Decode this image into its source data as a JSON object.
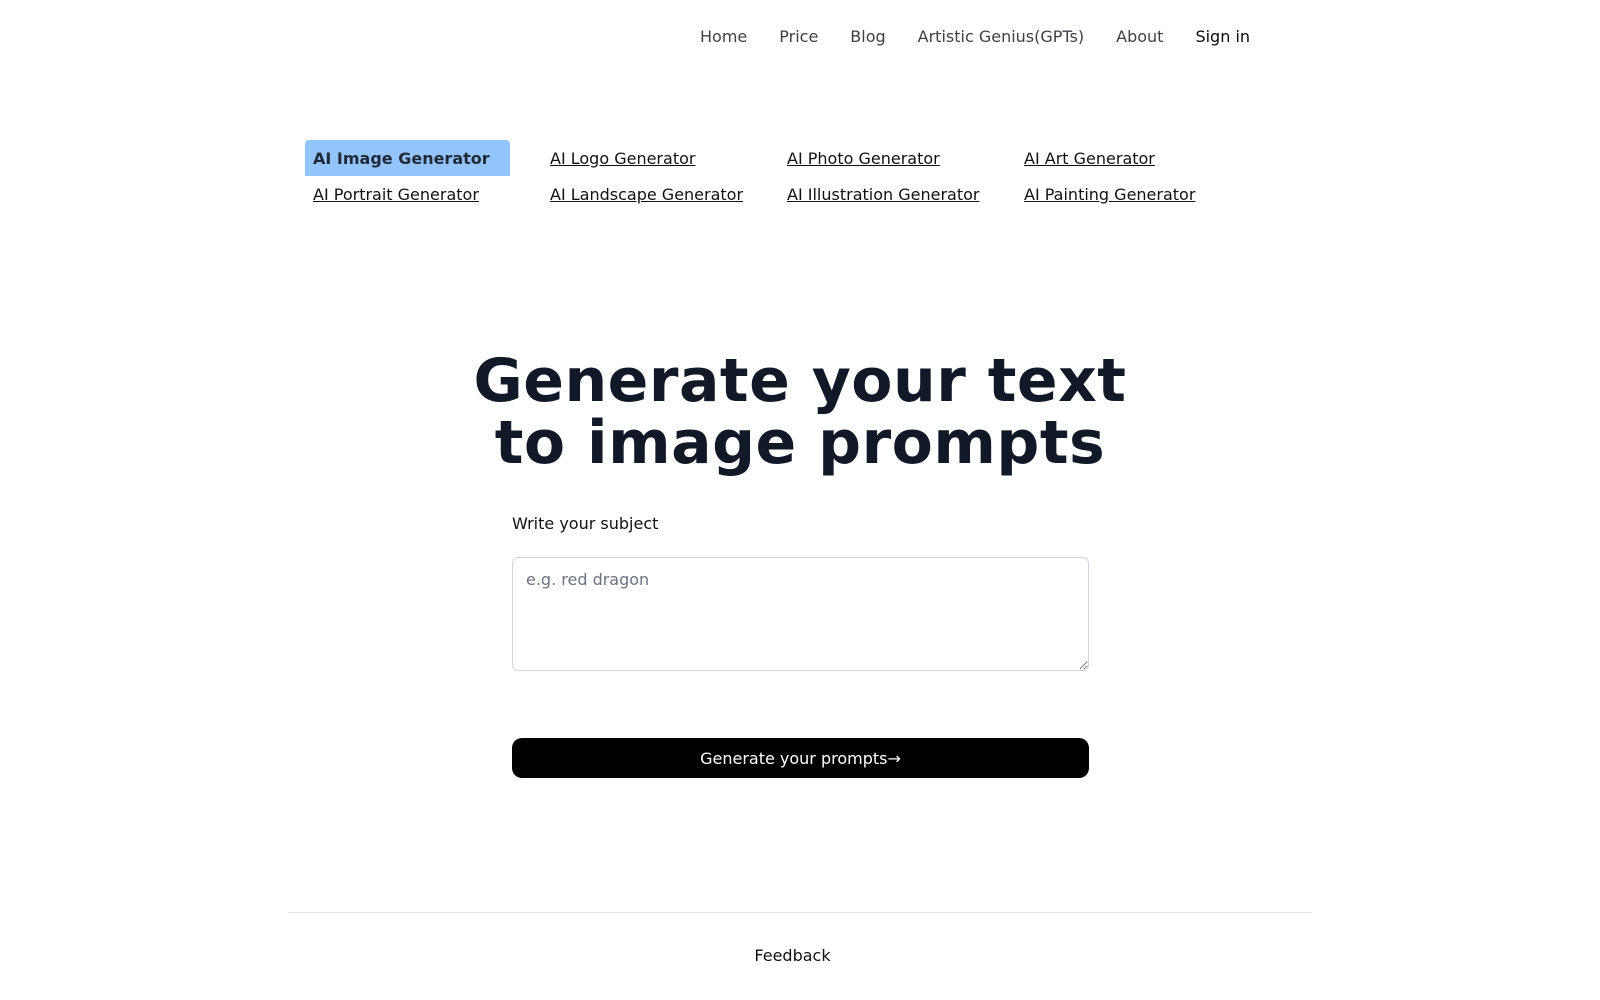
{
  "nav": {
    "home": "Home",
    "price": "Price",
    "blog": "Blog",
    "gpts": "Artistic Genius(GPTs)",
    "about": "About",
    "signin": "Sign in"
  },
  "generators": [
    "AI Image Generator",
    "AI Logo Generator",
    "AI Photo Generator",
    "AI Art Generator",
    "AI Portrait Generator",
    "AI Landscape Generator",
    "AI Illustration Generator",
    "AI Painting Generator"
  ],
  "active_generator": "AI Image Generator",
  "hero": {
    "title_line1": "Generate your text",
    "title_line2": "to image prompts"
  },
  "form": {
    "label": "Write your subject",
    "placeholder": "e.g. red dragon",
    "value": "",
    "button": "Generate your prompts→"
  },
  "footer": {
    "feedback": "Feedback"
  },
  "colors": {
    "active_tab_bg": "#93c5fd",
    "button_bg": "#000000",
    "title": "#111827"
  }
}
